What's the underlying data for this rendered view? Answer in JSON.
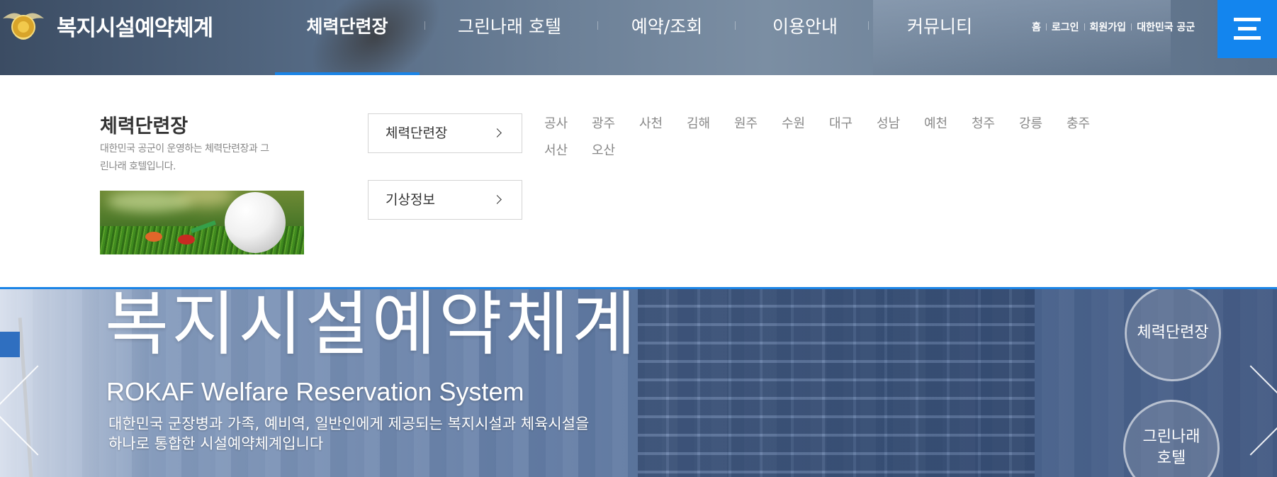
{
  "header": {
    "site_title": "복지시설예약체계",
    "gnb": [
      {
        "label": "체력단련장",
        "active": true
      },
      {
        "label": "그린나래 호텔",
        "active": false
      },
      {
        "label": "예약/조회",
        "active": false
      },
      {
        "label": "이용안내",
        "active": false
      },
      {
        "label": "커뮤니티",
        "active": false
      }
    ],
    "util_links": [
      "홈",
      "로그인",
      "회원가입",
      "대한민국 공군"
    ],
    "menu_icon": "hamburger-menu-icon",
    "accent_color": "#1385ee"
  },
  "dropdown": {
    "title": "체력단련장",
    "description": "대한민국 공군이 운영하는 체력단련장과 그린나래 호텔입니다.",
    "image_icon": "golf-ball-image",
    "buttons": [
      {
        "label": "체력단련장",
        "icon": "chevron-right-icon"
      },
      {
        "label": "기상정보",
        "icon": "chevron-right-icon"
      }
    ],
    "locations": [
      "공사",
      "광주",
      "사천",
      "김해",
      "원주",
      "수원",
      "대구",
      "성남",
      "예천",
      "청주",
      "강릉",
      "충주",
      "서산",
      "오산"
    ]
  },
  "hero": {
    "title_ko": "복지시설예약체계",
    "title_en": "ROKAF Welfare Reservation System",
    "description_line1": "대한민국 군장병과 가족, 예비역, 일반인에게 제공되는 복지시설과 체육시설을",
    "description_line2": "하나로 통합한 시설예약체계입니다",
    "quick_links": [
      "체력단련장",
      "그린나래 호텔"
    ],
    "prev_icon": "chevron-left-icon",
    "next_icon": "chevron-right-icon"
  }
}
